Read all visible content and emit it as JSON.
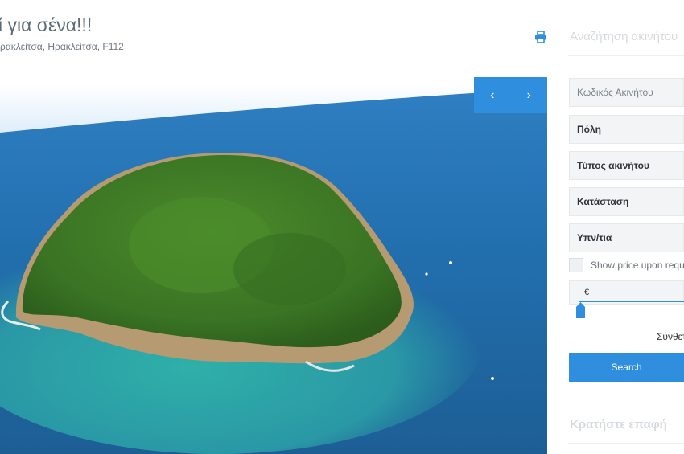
{
  "listing": {
    "title": "ί για σένα!!!",
    "address": "ρακλείτσα, Ηρακλείτσα, F112"
  },
  "gallery": {
    "prev_label": "‹",
    "next_label": "›",
    "accent_color": "#2f8fde"
  },
  "sidebar": {
    "search_heading": "Αναζήτηση ακινήτου",
    "property_code_placeholder": "Κωδικός Ακινήτου",
    "city_label": "Πόλη",
    "property_type_label": "Τύπος ακινήτου",
    "status_label": "Κατάσταση",
    "bedrooms_label": "Υπν/τια",
    "show_price_label": "Show price upon request",
    "price_currency": "€",
    "advanced_link": "Σύνθετη",
    "search_button": "Search",
    "contact_heading": "Κρατήστε επαφή"
  },
  "icons": {
    "print": "print-icon"
  }
}
